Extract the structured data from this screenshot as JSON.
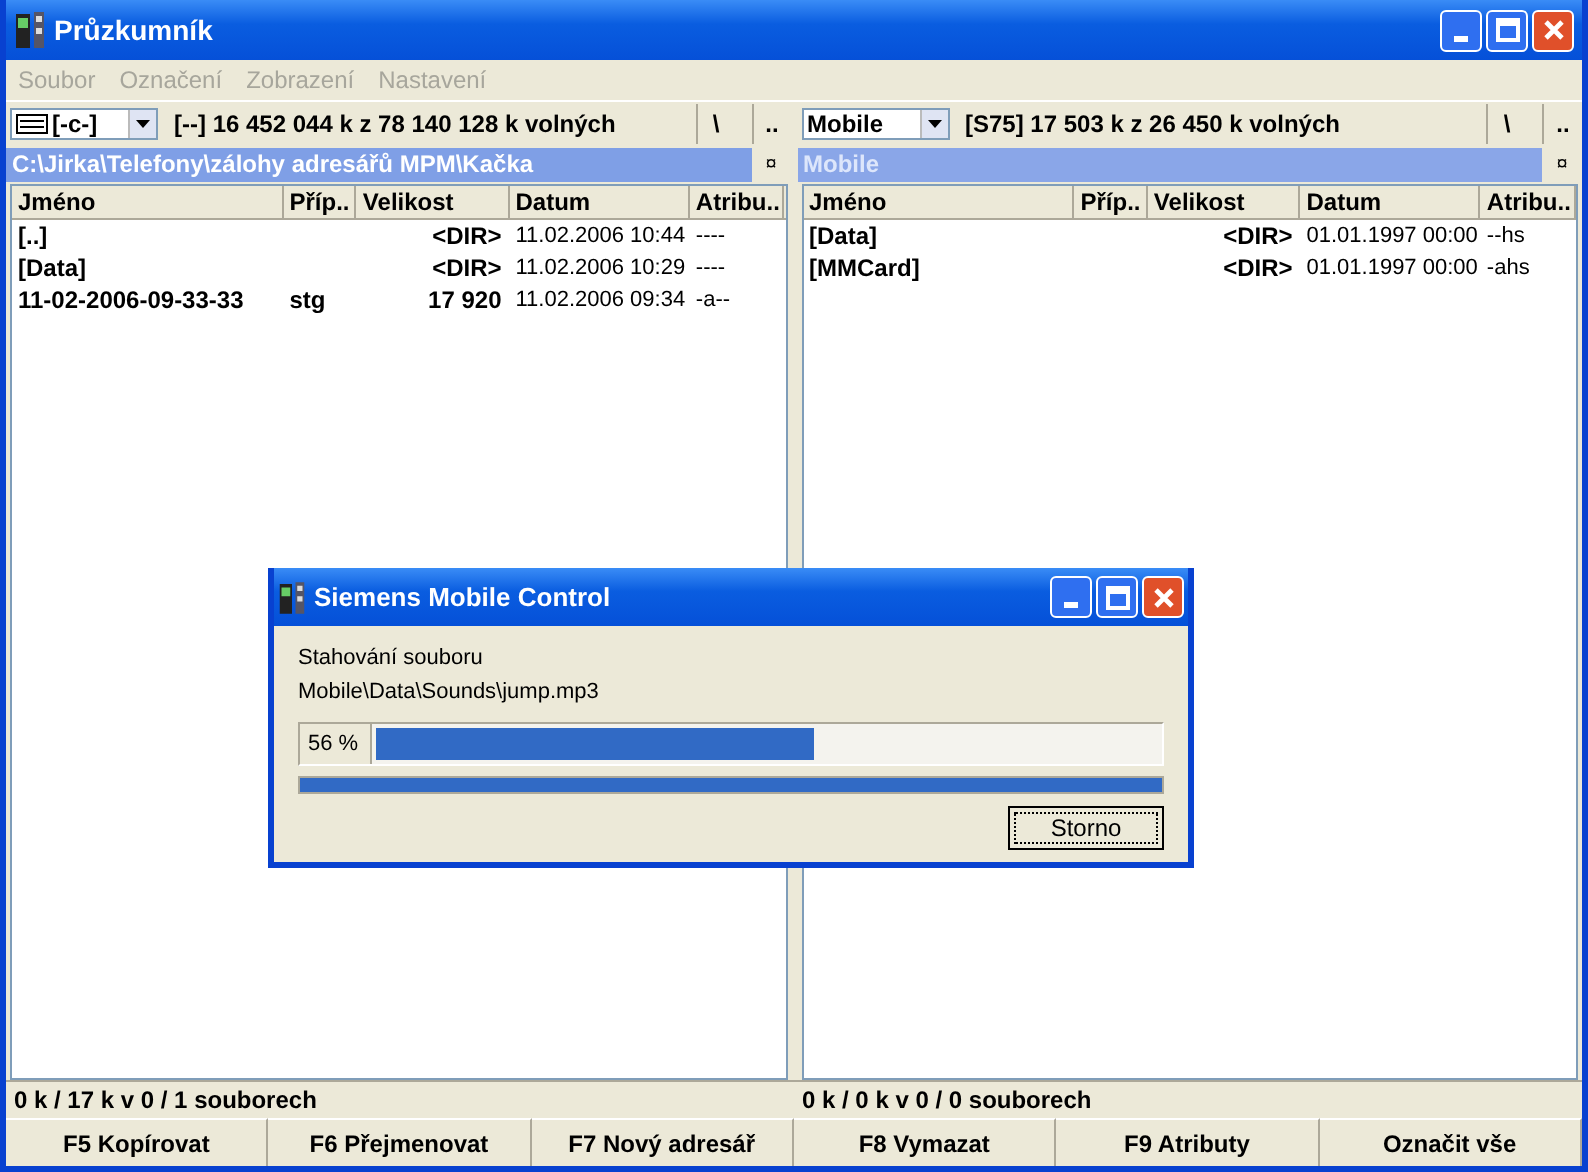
{
  "window": {
    "title": "Průzkumník"
  },
  "menu": [
    {
      "label": "Soubor",
      "disabled": true
    },
    {
      "label": "Označení",
      "disabled": true
    },
    {
      "label": "Zobrazení",
      "disabled": true
    },
    {
      "label": "Nastavení",
      "disabled": true
    }
  ],
  "panels": [
    {
      "drive": "[-c-]",
      "drive_icon": true,
      "free_info": "[--]  16 452 044 k z 78 140 128 k volných",
      "root_button": "\\",
      "up_button": "..",
      "path": "C:\\Jirka\\Telefony\\zálohy adresářů MPM\\Kačka",
      "path_active": true,
      "pin": "¤",
      "columns": [
        "Jméno",
        "Příp..",
        "Velikost",
        "Datum",
        "Atribu.."
      ],
      "rows": [
        [
          "[..]",
          "",
          "<DIR>",
          "11.02.2006 10:44",
          "----"
        ],
        [
          "[Data]",
          "",
          "<DIR>",
          "11.02.2006 10:29",
          "----"
        ],
        [
          "11-02-2006-09-33-33",
          "stg",
          "17 920",
          "11.02.2006 09:34",
          "-a--"
        ]
      ],
      "status": "0 k / 17 k v 0 / 1 souborech"
    },
    {
      "drive": "Mobile",
      "drive_icon": false,
      "free_info": "[S75]  17 503 k z 26 450 k volných",
      "root_button": "\\",
      "up_button": "..",
      "path": "Mobile",
      "path_active": false,
      "pin": "¤",
      "columns": [
        "Jméno",
        "Příp..",
        "Velikost",
        "Datum",
        "Atribu.."
      ],
      "rows": [
        [
          "[Data]",
          "",
          "<DIR>",
          "01.01.1997 00:00",
          "--hs"
        ],
        [
          "[MMCard]",
          "",
          "<DIR>",
          "01.01.1997 00:00",
          "-ahs"
        ]
      ],
      "status": "0 k / 0 k v 0 / 0 souborech"
    }
  ],
  "function_keys": [
    "F5 Kopírovat",
    "F6 Přejmenovat",
    "F7 Nový adresář",
    "F8 Vymazat",
    "F9 Atributy",
    "Označit vše"
  ],
  "dialog": {
    "title": "Siemens Mobile Control",
    "lines": [
      "Stahování souboru",
      "Mobile\\Data\\Sounds\\jump.mp3"
    ],
    "percent": "56 %",
    "file_progress": {
      "level": 0.56
    },
    "total_progress": {
      "level": 1.0
    },
    "button": "Storno"
  }
}
